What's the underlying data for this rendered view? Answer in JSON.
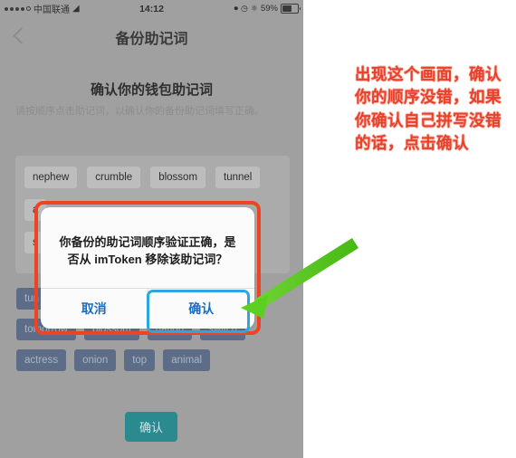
{
  "phone": {
    "statusbar": {
      "carrier": "中国联通",
      "wifi_icon": "wifi-icon",
      "time": "14:12",
      "rotation_lock_icon": "rotation-lock-icon",
      "alarm_icon": "alarm-clock-icon",
      "bluetooth_icon": "bluetooth-icon",
      "battery_percent": "59%",
      "battery_icon": "battery-icon"
    },
    "navbar": {
      "back_icon": "back-chevron-icon",
      "title": "备份助记词"
    },
    "page": {
      "title": "确认你的钱包助记词",
      "subtitle": "请按顺序点击助记词，以确认你的备份助记词填写正确。"
    },
    "word_pool": {
      "rows": [
        [
          "nephew",
          "crumble",
          "blossom",
          "tunnel"
        ],
        [
          "a",
          "",
          "",
          ""
        ],
        [
          "s",
          "",
          "",
          ""
        ]
      ]
    },
    "selected_words": {
      "rows": [
        [
          "tun"
        ],
        [
          "tomorrow",
          "blossom",
          "nation",
          "switch"
        ],
        [
          "actress",
          "onion",
          "top",
          "animal"
        ]
      ]
    },
    "bottom_button": {
      "label": "确认"
    },
    "dialog": {
      "message": "你备份的助记词顺序验证正确，是否从 imToken 移除该助记词？",
      "cancel_label": "取消",
      "confirm_label": "确认"
    }
  },
  "annotation": {
    "text": "出现这个画面，确认你的顺序没错，如果你确认自己拼写没错的话，点击确认",
    "arrow_icon": "green-arrow-icon",
    "colors": {
      "annotation_red": "#e8402a",
      "highlight_red": "#ef4423",
      "highlight_blue": "#2ca6e0",
      "arrow_green": "#5bd021",
      "confirm_teal": "#2a8a8f",
      "chip_selected": "#5d6d88"
    }
  }
}
